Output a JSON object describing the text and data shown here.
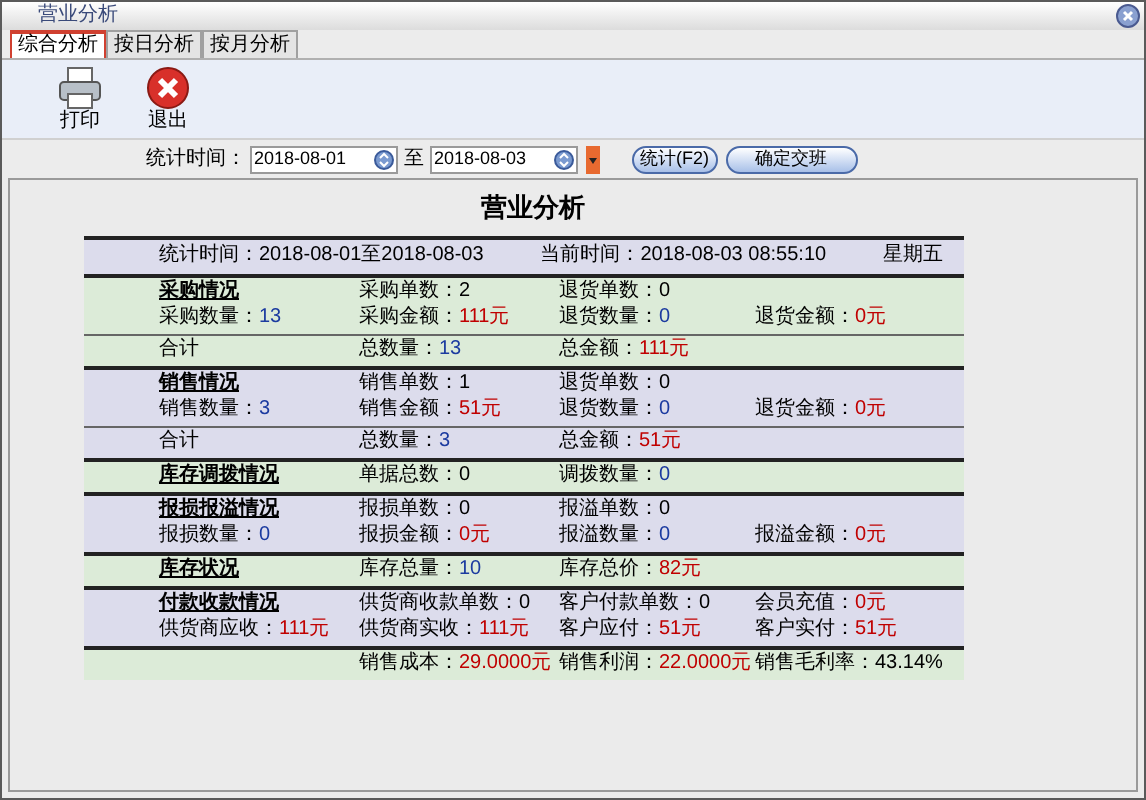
{
  "window": {
    "title": "营业分析"
  },
  "tabs": [
    {
      "label": "综合分析",
      "selected": true
    },
    {
      "label": "按日分析",
      "selected": false
    },
    {
      "label": "按月分析",
      "selected": false
    }
  ],
  "toolbar": [
    {
      "kind": "print",
      "label": "打印"
    },
    {
      "kind": "exit",
      "label": "退出"
    }
  ],
  "filter": {
    "label": "统计时间：",
    "start": "2018-08-01",
    "separator": "至",
    "end": "2018-08-03",
    "buttons": [
      {
        "label": "统计(F2)"
      },
      {
        "label": "确定交班"
      }
    ]
  },
  "report": {
    "title": "营业分析",
    "header": {
      "color": "#dcdcec",
      "cells": [
        {
          "label": "统计时间：",
          "value": "2018-08-01至2018-08-03"
        },
        {
          "label": "当前时间：",
          "value": "2018-08-03 08:55:10"
        },
        {
          "value": "星期五"
        }
      ]
    },
    "sections": [
      {
        "kind": "main",
        "color": "#dcebd8",
        "rows": [
          [
            {
              "kind": "heading",
              "label": "采购情况"
            },
            {
              "kind": "field",
              "label": "采购单数：",
              "value": "2",
              "color": "#000000"
            },
            {
              "kind": "field",
              "label": "退货单数：",
              "value": "0",
              "color": "#000000"
            }
          ],
          [
            {
              "kind": "field",
              "label": "采购数量：",
              "value": "13",
              "color": "#1c3ba0"
            },
            {
              "kind": "field",
              "label": "采购金额：",
              "value": "111元",
              "color": "#c00000"
            },
            {
              "kind": "field",
              "label": "退货数量：",
              "value": "0",
              "color": "#1c3ba0"
            },
            {
              "kind": "field",
              "label": "退货金额：",
              "value": "0元",
              "color": "#c00000"
            }
          ]
        ]
      },
      {
        "kind": "total",
        "color": "#dcebd8",
        "rows": [
          [
            {
              "kind": "text",
              "label": "合计"
            },
            {
              "kind": "field",
              "label": "总数量：",
              "value": "13",
              "color": "#1c3ba0"
            },
            {
              "kind": "field",
              "label": "总金额：",
              "value": "111元",
              "color": "#c00000"
            }
          ]
        ]
      },
      {
        "kind": "main",
        "color": "#dcdcec",
        "rows": [
          [
            {
              "kind": "heading",
              "label": "销售情况"
            },
            {
              "kind": "field",
              "label": "销售单数：",
              "value": "1",
              "color": "#000000"
            },
            {
              "kind": "field",
              "label": "退货单数：",
              "value": "0",
              "color": "#000000"
            }
          ],
          [
            {
              "kind": "field",
              "label": "销售数量：",
              "value": "3",
              "color": "#1c3ba0"
            },
            {
              "kind": "field",
              "label": "销售金额：",
              "value": "51元",
              "color": "#c00000"
            },
            {
              "kind": "field",
              "label": "退货数量：",
              "value": "0",
              "color": "#1c3ba0"
            },
            {
              "kind": "field",
              "label": "退货金额：",
              "value": "0元",
              "color": "#c00000"
            }
          ]
        ]
      },
      {
        "kind": "total",
        "color": "#dcdcec",
        "rows": [
          [
            {
              "kind": "text",
              "label": "合计"
            },
            {
              "kind": "field",
              "label": "总数量：",
              "value": "3",
              "color": "#1c3ba0"
            },
            {
              "kind": "field",
              "label": "总金额：",
              "value": "51元",
              "color": "#c00000"
            }
          ]
        ]
      },
      {
        "kind": "main",
        "color": "#dcebd8",
        "rows": [
          [
            {
              "kind": "heading",
              "label": "库存调拨情况"
            },
            {
              "kind": "field",
              "label": "单据总数：",
              "value": "0",
              "color": "#000000"
            },
            {
              "kind": "field",
              "label": "调拨数量：",
              "value": "0",
              "color": "#1c3ba0"
            }
          ]
        ]
      },
      {
        "kind": "main",
        "color": "#dcdcec",
        "rows": [
          [
            {
              "kind": "heading",
              "label": "报损报溢情况"
            },
            {
              "kind": "field",
              "label": "报损单数：",
              "value": "0",
              "color": "#000000"
            },
            {
              "kind": "field",
              "label": "报溢单数：",
              "value": "0",
              "color": "#000000"
            }
          ],
          [
            {
              "kind": "field",
              "label": "报损数量：",
              "value": "0",
              "color": "#1c3ba0"
            },
            {
              "kind": "field",
              "label": "报损金额：",
              "value": "0元",
              "color": "#c00000"
            },
            {
              "kind": "field",
              "label": "报溢数量：",
              "value": "0",
              "color": "#1c3ba0"
            },
            {
              "kind": "field",
              "label": "报溢金额：",
              "value": "0元",
              "color": "#c00000"
            }
          ]
        ]
      },
      {
        "kind": "main",
        "color": "#dcebd8",
        "rows": [
          [
            {
              "kind": "heading",
              "label": "库存状况"
            },
            {
              "kind": "field",
              "label": "库存总量：",
              "value": "10",
              "color": "#1c3ba0"
            },
            {
              "kind": "field",
              "label": "库存总价：",
              "value": "82元",
              "color": "#c00000"
            }
          ]
        ]
      },
      {
        "kind": "main",
        "color": "#dcdcec",
        "rows": [
          [
            {
              "kind": "heading",
              "label": "付款收款情况"
            },
            {
              "kind": "field",
              "label": "供货商收款单数：",
              "value": "0",
              "color": "#000000"
            },
            {
              "kind": "field",
              "label": "客户付款单数：",
              "value": "0",
              "color": "#000000"
            },
            {
              "kind": "field",
              "label": "会员充值：",
              "value": "0元",
              "color": "#c00000"
            }
          ],
          [
            {
              "kind": "field",
              "label": "供货商应收：",
              "value": "111元",
              "color": "#c00000"
            },
            {
              "kind": "field",
              "label": "供货商实收：",
              "value": "111元",
              "color": "#c00000"
            },
            {
              "kind": "field",
              "label": "客户应付：",
              "value": "51元",
              "color": "#c00000"
            },
            {
              "kind": "field",
              "label": "客户实付：",
              "value": "51元",
              "color": "#c00000"
            }
          ]
        ]
      },
      {
        "kind": "summary",
        "color": "#dcebd8",
        "rows": [
          [
            {
              "kind": "field",
              "label": "销售成本：",
              "value": "29.0000元",
              "color": "#c00000"
            },
            {
              "kind": "field",
              "label": "销售利润：",
              "value": "22.0000元",
              "color": "#c00000"
            },
            {
              "kind": "field",
              "label": "销售毛利率：",
              "value": "43.14%",
              "color": "#000000"
            }
          ]
        ]
      }
    ]
  }
}
